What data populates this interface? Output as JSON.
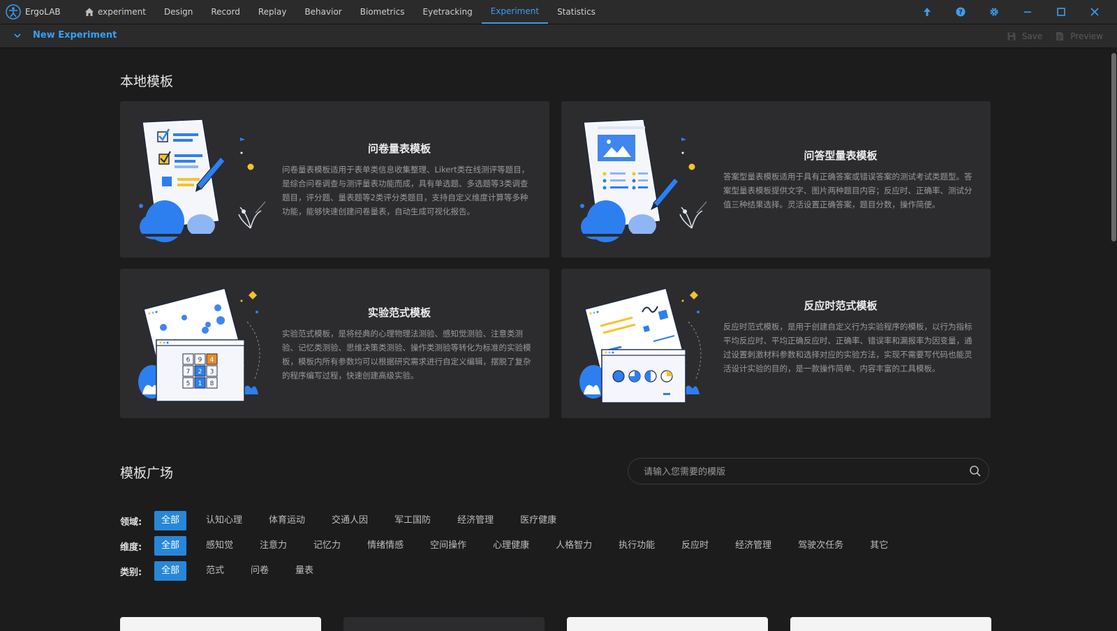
{
  "app": {
    "name": "ErgoLAB"
  },
  "nav": {
    "items": [
      {
        "label": "experiment",
        "icon": "home-icon"
      },
      {
        "label": "Design"
      },
      {
        "label": "Record"
      },
      {
        "label": "Replay"
      },
      {
        "label": "Behavior"
      },
      {
        "label": "Biometrics"
      },
      {
        "label": "Eyetracking"
      },
      {
        "label": "Experiment",
        "active": true
      },
      {
        "label": "Statistics"
      }
    ]
  },
  "window_controls": [
    "upload-icon",
    "help-icon",
    "settings-icon",
    "minimize-icon",
    "maximize-icon",
    "close-icon"
  ],
  "subbar": {
    "title": "New Experiment",
    "save_label": "Save",
    "preview_label": "Preview"
  },
  "local_templates": {
    "title": "本地模板",
    "cards": [
      {
        "title": "问卷量表模板",
        "description": "问卷量表模板适用于表单类信息收集整理、Likert类在线测评等题目，是综合问卷调查与测评量表功能而成，具有单选题、多选题等3类调查题目，评分题、量表题等2类评分类题目，支持自定义维度计算等多种功能，能够快速创建问卷量表，自动生成可视化报告。"
      },
      {
        "title": "问答型量表模板",
        "description": "答案型量表模板适用于具有正确答案或错误答案的测试考试类题型。答案型量表模板提供文字、图片两种题目内容；反应时、正确率、测试分值三种结果选择。灵活设置正确答案，题目分数，操作简便。"
      },
      {
        "title": "实验范式模板",
        "description": "实验范式模板，是将经典的心理物理法测验、感知觉测验、注意类测验、记忆类测验、思维决策类测验、操作类测验等转化为标准的实验模板，模板内所有参数均可以根据研究需求进行自定义编辑，摆脱了复杂的程序编写过程，快速创建高级实验。",
        "grid": [
          "6",
          "9",
          "4",
          "7",
          "2",
          "3",
          "5",
          "1",
          "8"
        ]
      },
      {
        "title": "反应时范式模板",
        "description": "反应时范式模板，是用于创建自定义行为实验程序的模板，以行为指标平均反应时、平均正确反应时、正确率、错误率和漏报率为因变量，通过设置刺激材料参数和选择对应的实验方法，实现不需要写代码也能灵活设计实验的目的，是一款操作简单、内容丰富的工具模板。"
      }
    ]
  },
  "template_square": {
    "title": "模板广场",
    "search_placeholder": "请输入您需要的模版",
    "filters": [
      {
        "label": "领域:",
        "options": [
          "全部",
          "认知心理",
          "体育运动",
          "交通人因",
          "军工国防",
          "经济管理",
          "医疗健康"
        ],
        "selected": "全部"
      },
      {
        "label": "维度:",
        "options": [
          "全部",
          "感知觉",
          "注意力",
          "记忆力",
          "情绪情感",
          "空间操作",
          "心理健康",
          "人格智力",
          "执行功能",
          "反应时",
          "经济管理",
          "驾驶次任务",
          "其它"
        ],
        "selected": "全部"
      },
      {
        "label": "类别:",
        "options": [
          "全部",
          "范式",
          "问卷",
          "量表"
        ],
        "selected": "全部"
      }
    ]
  },
  "colors": {
    "accent": "#3a9ff0",
    "chip_active": "#2787d9",
    "background": "#1c1c1d",
    "card": "#2c2c2e",
    "bar": "#2b2b2c"
  }
}
